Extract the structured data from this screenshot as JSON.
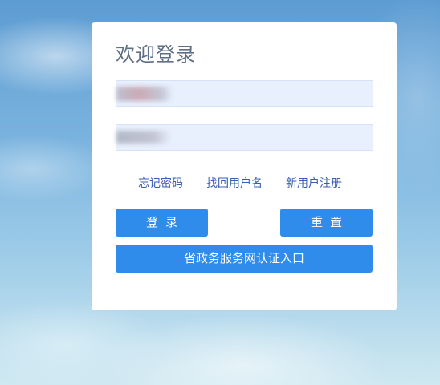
{
  "login": {
    "title": "欢迎登录",
    "username": {
      "value": "",
      "placeholder": ""
    },
    "password": {
      "value": "",
      "placeholder": ""
    },
    "links": {
      "forgot_password": "忘记密码",
      "recover_username": "找回用户名",
      "register": "新用户注册"
    },
    "buttons": {
      "login": "登录",
      "reset": "重置",
      "gov_auth": "省政务服务网认证入口"
    }
  },
  "colors": {
    "primary_button": "#2f8ceb",
    "input_background": "#e8f0fd",
    "link": "#3a5fb0",
    "title": "#5f6f86"
  }
}
